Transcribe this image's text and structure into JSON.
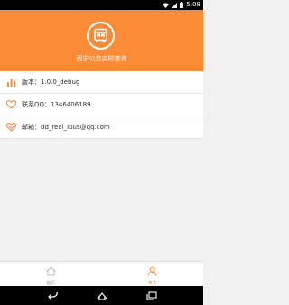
{
  "status_bar": {
    "time": "5:08",
    "icons": [
      "wifi-icon",
      "signal-icon",
      "battery-icon"
    ]
  },
  "header": {
    "logo_icon": "bus-icon",
    "title": "西宁公交实时查询",
    "background": "#fc8b38"
  },
  "info": [
    {
      "icon": "bar-chart-icon",
      "text": "版本：1.0.0_debug"
    },
    {
      "icon": "heart-icon",
      "text": "联系QQ：1346406189"
    },
    {
      "icon": "email-icon",
      "text": "邮箱：dd_real_ibus@qq.com"
    }
  ],
  "tabs": [
    {
      "icon": "home-icon",
      "label": "首页",
      "active": false
    },
    {
      "icon": "person-icon",
      "label": "关于",
      "active": true
    }
  ],
  "nav": [
    "back-icon",
    "home-icon",
    "recents-icon"
  ],
  "accent_color": "#fc8b38"
}
